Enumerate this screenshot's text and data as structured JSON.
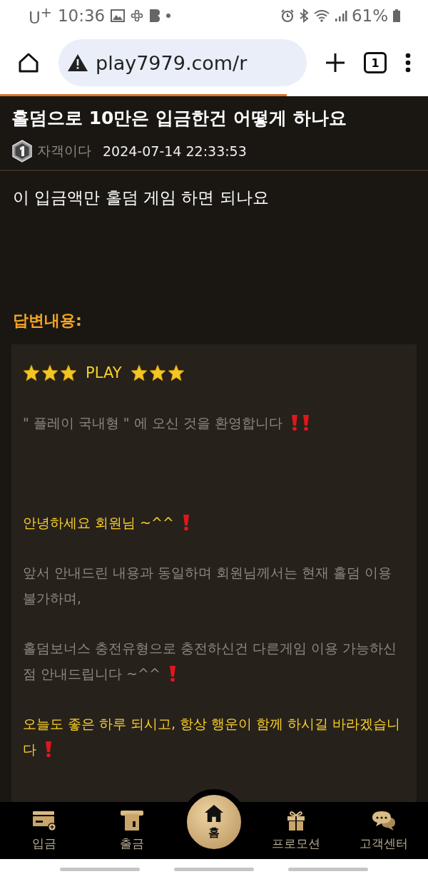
{
  "status_bar": {
    "carrier": "U$^{+}$",
    "time": "10:36",
    "battery": "61%"
  },
  "browser": {
    "url": "play7979.com/r",
    "tab_count": "1",
    "load_progress": {
      "level": 0.67
    }
  },
  "post": {
    "title": "홀덤으로 10만은 입금한건 어떻게 하나요",
    "author": "자객이다",
    "date": "2024-07-14 22:33:53",
    "body": "이 입금액만 홀덤 게임 하면 되나요"
  },
  "answer": {
    "label": "답변내용:",
    "paragraphs": [
      {
        "kind": "stars",
        "text": "PLAY",
        "alert": false,
        "double_alert": false
      },
      {
        "kind": "intro",
        "text": "\" 플레이 국내형 \" 에 오신 것을 환영합니다",
        "alert": true,
        "double_alert": true
      },
      {
        "kind": "greeting",
        "text": "안녕하세요 회원님 ~^^",
        "alert": true,
        "double_alert": false
      },
      {
        "kind": "text",
        "text": "앞서 안내드린 내용과 동일하며 회원님께서는 현재 홀덤 이용 불가하며,",
        "alert": false,
        "double_alert": false
      },
      {
        "kind": "text",
        "text": "홀덤보너스 충전유형으로 충전하신건 다른게임 이용 가능하신 점 안내드립니다 ~^^",
        "alert": true,
        "double_alert": false
      },
      {
        "kind": "greeting",
        "text": "오늘도 좋은 하루 되시고, 항상 행운이 함께 하시길 바라겠습니다",
        "alert": true,
        "double_alert": false
      }
    ]
  },
  "nav": [
    {
      "label": "입금",
      "selected": false
    },
    {
      "label": "출금",
      "selected": false
    },
    {
      "label": "홈",
      "selected": true
    },
    {
      "label": "프로모션",
      "selected": false
    },
    {
      "label": "고객센터",
      "selected": false
    }
  ]
}
